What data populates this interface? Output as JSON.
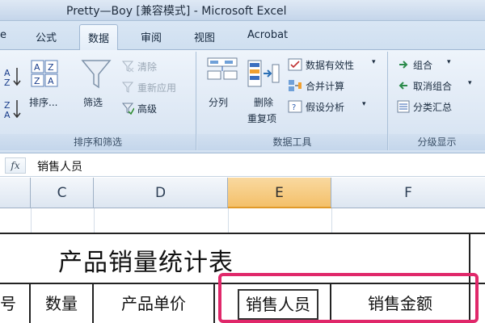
{
  "window": {
    "title": "Pretty—Boy  [兼容模式] - Microsoft Excel"
  },
  "tabs": [
    {
      "label": "e"
    },
    {
      "label": "公式"
    },
    {
      "label": "数据",
      "active": true
    },
    {
      "label": "审阅"
    },
    {
      "label": "视图"
    },
    {
      "label": "Acrobat"
    }
  ],
  "ribbon": {
    "sort_filter": {
      "label": "排序和筛选",
      "sort": "排序...",
      "filter": "筛选",
      "clear": "清除",
      "reapply": "重新应用",
      "advanced": "高级"
    },
    "data_tools": {
      "label": "数据工具",
      "text_to_columns": "分列",
      "remove_dup_1": "删除",
      "remove_dup_2": "重复项",
      "validation": "数据有效性",
      "consolidate": "合并计算",
      "what_if": "假设分析"
    },
    "outline": {
      "label": "分级显示",
      "group": "组合",
      "ungroup": "取消组合",
      "subtotal": "分类汇总"
    }
  },
  "formula_bar": {
    "fx_label": "fx",
    "value": "销售人员"
  },
  "columns": [
    "C",
    "D",
    "E",
    "F"
  ],
  "sheet": {
    "title": "产品销量统计表",
    "headers": [
      "号",
      "数量",
      "产品单价",
      "销售人员",
      "销售金额"
    ]
  },
  "colors": {
    "highlight": "#e0286a",
    "selected_column": "#f4c06a"
  }
}
